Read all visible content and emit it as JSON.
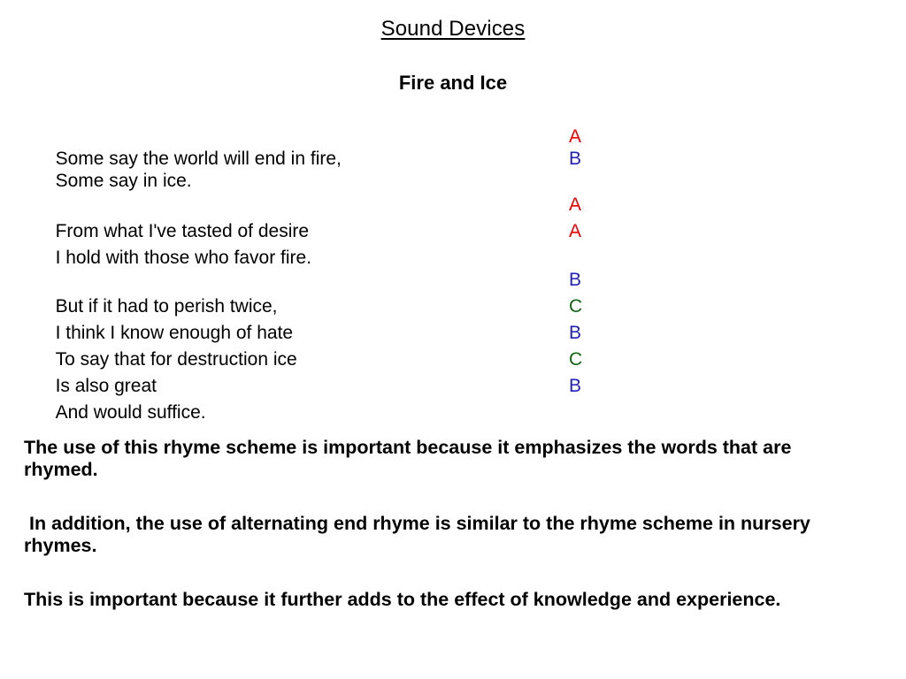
{
  "slide": {
    "title": "Sound Devices",
    "poem_title": "Fire and Ice",
    "background_color": "#ffffff",
    "text_color": "#000000"
  },
  "rhyme_colors": {
    "A": "#ee0000",
    "B": "#2222bb",
    "C": "#116611"
  },
  "poem": {
    "stanzas": [
      {
        "lines": [
          {
            "text": "Some say the world will end in fire,",
            "rhyme": "A"
          },
          {
            "text": "Some say in ice.",
            "rhyme": "B"
          }
        ]
      },
      {
        "lines": [
          {
            "text": "From what I've tasted of desire",
            "rhyme": "A"
          },
          {
            "text": "I hold with those who favor fire.",
            "rhyme": "A"
          }
        ]
      },
      {
        "lines": [
          {
            "text": "But if it had to perish twice,",
            "rhyme": "B"
          },
          {
            "text": "I think I know enough of hate",
            "rhyme": "C"
          },
          {
            "text": "To say that for destruction ice",
            "rhyme": "B"
          },
          {
            "text": "Is also great",
            "rhyme": "C"
          },
          {
            "text": "And would suffice.",
            "rhyme": "B"
          }
        ]
      }
    ]
  },
  "commentary": {
    "note_1": "The use of this rhyme scheme is important because it emphasizes the words that are rhymed.",
    "note_2": " In addition, the use of alternating end rhyme is similar to the rhyme scheme in nursery rhymes.",
    "note_3": "This is important because it further adds to the effect of knowledge and experience."
  }
}
